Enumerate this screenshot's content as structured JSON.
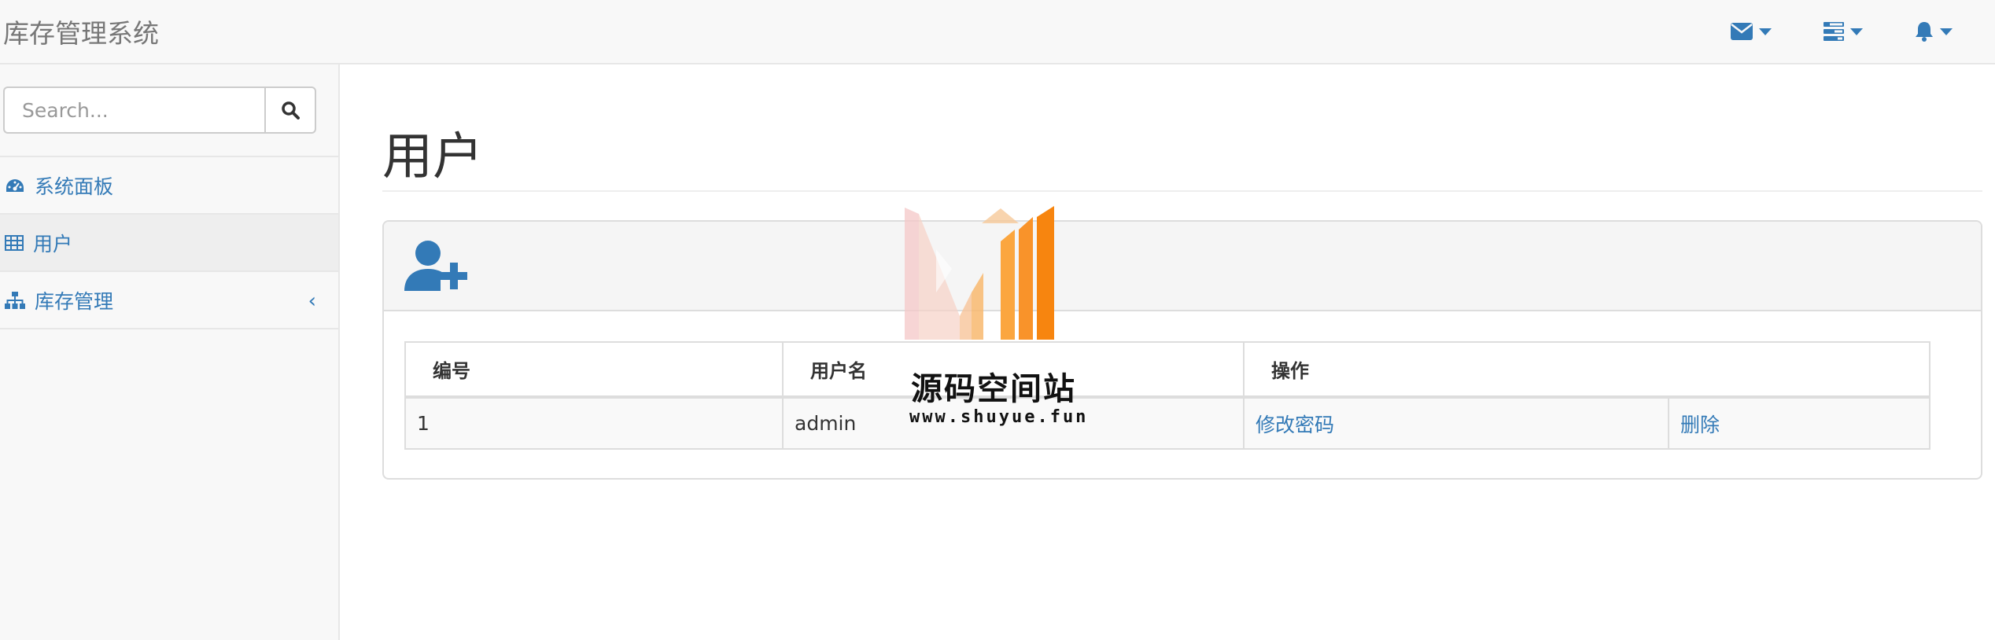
{
  "app": {
    "brand": "库存管理系统"
  },
  "navbar": {
    "icons": [
      "envelope-icon",
      "tasks-icon",
      "bell-icon"
    ],
    "accent": "#337ab7"
  },
  "sidebar": {
    "search": {
      "placeholder": "Search...",
      "value": ""
    },
    "items": [
      {
        "label": "系统面板",
        "icon": "dashboard-icon"
      },
      {
        "label": "用户",
        "icon": "table-icon",
        "active": true
      },
      {
        "label": "库存管理",
        "icon": "sitemap-icon",
        "arrow": "‹"
      }
    ]
  },
  "main": {
    "title": "用户",
    "panel": {
      "heading_icon": "add-user-icon",
      "table": {
        "headers": [
          "编号",
          "用户名",
          "操作"
        ],
        "rows": [
          {
            "id": "1",
            "username": "admin",
            "action_edit": "修改密码",
            "action_delete": "删除"
          }
        ]
      }
    }
  },
  "watermark": {
    "title": "源码空间站",
    "url": "www.shuyue.fun"
  }
}
